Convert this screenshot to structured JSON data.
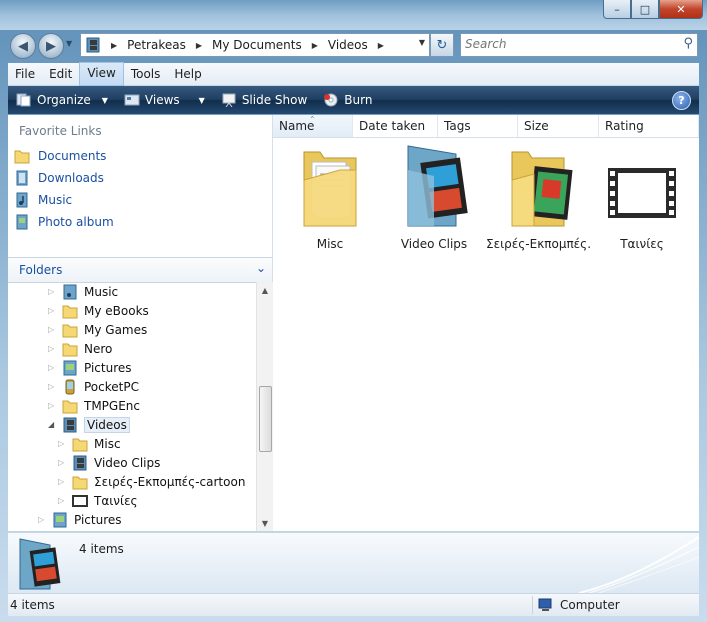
{
  "window": {
    "caption_buttons": {
      "minimize": "–",
      "maximize": "□",
      "close": "✕"
    }
  },
  "nav": {
    "back_icon": "back-arrow-icon",
    "forward_icon": "forward-arrow-icon",
    "breadcrumb": [
      "Petrakeas",
      "My Documents",
      "Videos"
    ],
    "search_placeholder": "Search"
  },
  "menu": [
    "File",
    "Edit",
    "View",
    "Tools",
    "Help"
  ],
  "menu_active": "View",
  "toolbar": {
    "organize": "Organize",
    "views": "Views",
    "slideshow": "Slide Show",
    "burn": "Burn",
    "help": "?"
  },
  "favorites": {
    "title": "Favorite Links",
    "items": [
      "Documents",
      "Downloads",
      "Music",
      "Photo album"
    ]
  },
  "folders": {
    "title": "Folders",
    "tree": [
      "Music",
      "My eBooks",
      "My Games",
      "Nero",
      "Pictures",
      "PocketPC",
      "TMPGEnc",
      "Videos",
      "Misc",
      "Video Clips",
      "Σειρές-Εκπομπές-cartoon",
      "Ταινίες",
      "Pictures"
    ]
  },
  "columns": [
    "Name",
    "Date taken",
    "Tags",
    "Size",
    "Rating"
  ],
  "items": [
    {
      "name": "Misc"
    },
    {
      "name": "Video Clips"
    },
    {
      "name": "Σειρές-Εκπομπές..."
    },
    {
      "name": "Ταινίες"
    }
  ],
  "details": {
    "count": "4 items"
  },
  "status": {
    "left": "4 items",
    "right": "Computer"
  },
  "colors": {
    "accent": "#1a4fa2",
    "toolbar": "#1f3f62",
    "selection": "#e6eef7"
  }
}
